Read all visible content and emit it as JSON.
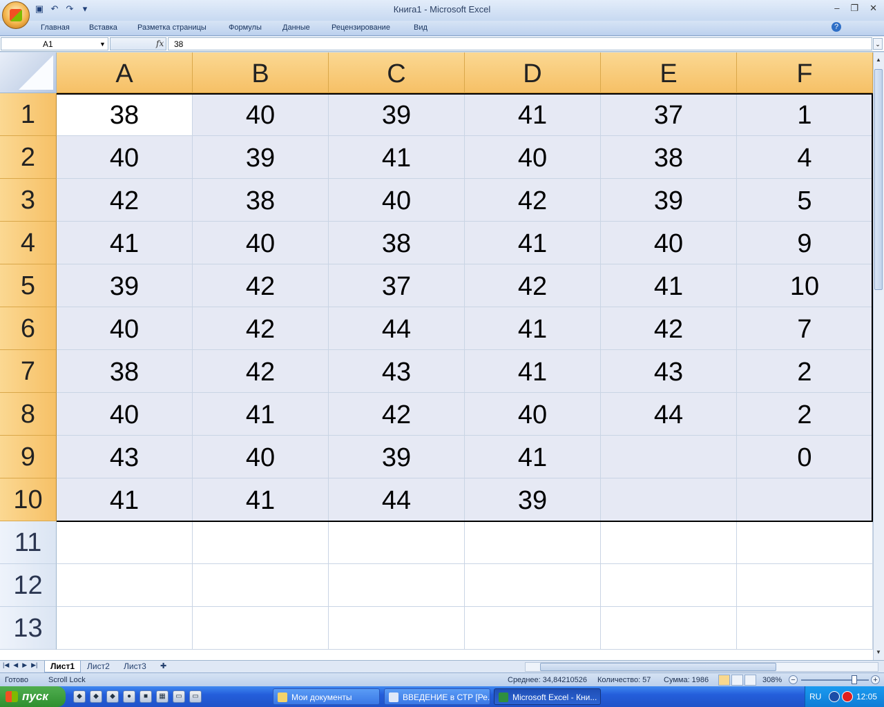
{
  "window": {
    "title": "Книга1 - Microsoft Excel",
    "controls": [
      "–",
      "❐",
      "✕"
    ]
  },
  "ribbon": {
    "tabs": [
      "Главная",
      "Вставка",
      "Разметка страницы",
      "Формулы",
      "Данные",
      "Рецензирование",
      "Вид"
    ]
  },
  "formula_bar": {
    "name_box": "A1",
    "fx": "fx",
    "value": "38"
  },
  "sheet": {
    "columns": [
      "A",
      "B",
      "C",
      "D",
      "E",
      "F"
    ],
    "rows": [
      "1",
      "2",
      "3",
      "4",
      "5",
      "6",
      "7",
      "8",
      "9",
      "10",
      "11",
      "12",
      "13"
    ],
    "cells": [
      [
        "38",
        "40",
        "39",
        "41",
        "37",
        "1"
      ],
      [
        "40",
        "39",
        "41",
        "40",
        "38",
        "4"
      ],
      [
        "42",
        "38",
        "40",
        "42",
        "39",
        "5"
      ],
      [
        "41",
        "40",
        "38",
        "41",
        "40",
        "9"
      ],
      [
        "39",
        "42",
        "37",
        "42",
        "41",
        "10"
      ],
      [
        "40",
        "42",
        "44",
        "41",
        "42",
        "7"
      ],
      [
        "38",
        "42",
        "43",
        "41",
        "43",
        "2"
      ],
      [
        "40",
        "41",
        "42",
        "40",
        "44",
        "2"
      ],
      [
        "43",
        "40",
        "39",
        "41",
        "",
        "0"
      ],
      [
        "41",
        "41",
        "44",
        "39",
        "",
        ""
      ],
      [
        "",
        "",
        "",
        "",
        "",
        ""
      ],
      [
        "",
        "",
        "",
        "",
        "",
        ""
      ],
      [
        "",
        "",
        "",
        "",
        "",
        ""
      ]
    ],
    "selection_rows": 10,
    "active_cell": "A1"
  },
  "sheet_tabs": [
    "Лист1",
    "Лист2",
    "Лист3"
  ],
  "status": {
    "ready": "Готово",
    "scroll_lock": "Scroll Lock",
    "average": "Среднее: 34,84210526",
    "count": "Количество: 57",
    "sum": "Сумма: 1986",
    "zoom": "308%"
  },
  "taskbar": {
    "start": "пуск",
    "tasks": [
      "Мои документы",
      "ВВЕДЕНИЕ в СТР [Ре...",
      "Microsoft Excel - Кни..."
    ],
    "lang": "RU",
    "clock": "12:05"
  },
  "colors": {
    "header_selected": "#f6c066",
    "selection_fill": "#e6e9f4",
    "taskbar": "#245edb"
  }
}
